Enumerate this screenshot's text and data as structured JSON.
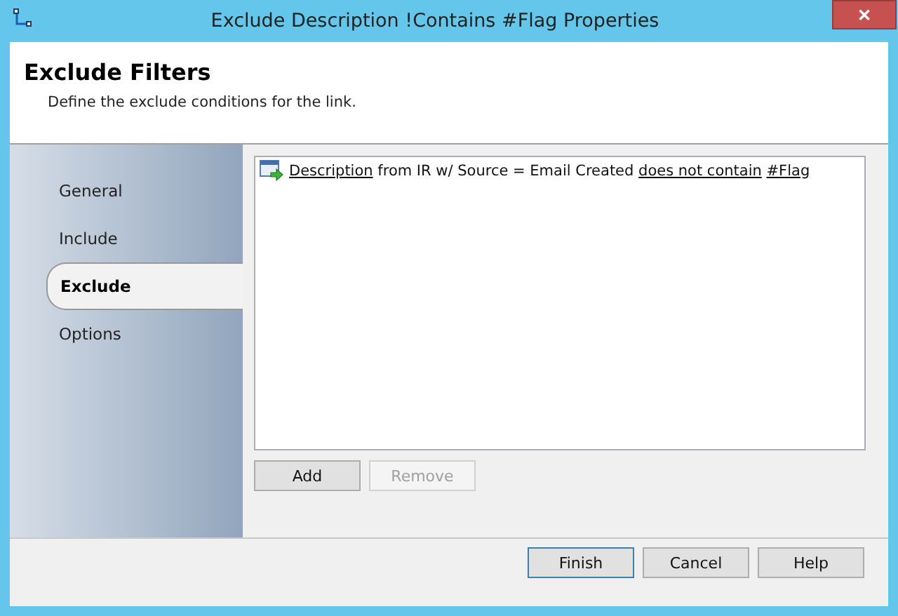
{
  "window": {
    "title": "Exclude Description !Contains #Flag Properties",
    "close": "✕"
  },
  "header": {
    "title": "Exclude Filters",
    "subtitle": "Define the exclude conditions for the link."
  },
  "nav": [
    {
      "label": "General",
      "selected": false
    },
    {
      "label": "Include",
      "selected": false
    },
    {
      "label": "Exclude",
      "selected": true
    },
    {
      "label": "Options",
      "selected": false
    }
  ],
  "conditions": [
    {
      "parts": [
        {
          "kind": "link",
          "text": "Description"
        },
        {
          "kind": "text",
          "text": "from IR w/ Source = Email Created"
        },
        {
          "kind": "link",
          "text": "does not contain"
        },
        {
          "kind": "link",
          "text": "#Flag"
        }
      ]
    }
  ],
  "list_buttons": [
    {
      "label": "Add",
      "disabled": false
    },
    {
      "label": "Remove",
      "disabled": true
    }
  ],
  "footer_buttons": [
    {
      "label": "Finish",
      "default": true
    },
    {
      "label": "Cancel",
      "default": false
    },
    {
      "label": "Help",
      "default": false
    }
  ]
}
